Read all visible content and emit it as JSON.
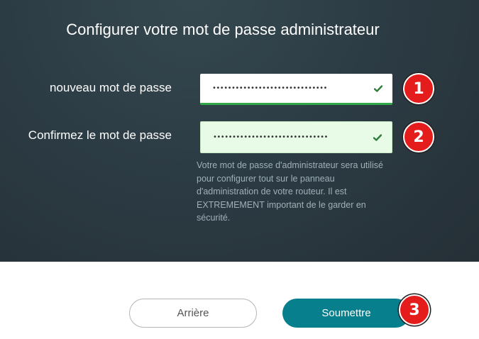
{
  "header": {
    "title": "Configurer votre mot de passe administrateur"
  },
  "form": {
    "new_password": {
      "label": "nouveau mot de passe",
      "masked_value": "••••••••••••••••••••••••••••••",
      "status_icon": "check-icon"
    },
    "confirm_password": {
      "label": "Confirmez le mot de passe",
      "masked_value": "••••••••••••••••••••••••••••••",
      "status_icon": "check-icon"
    },
    "help_text": "Votre mot de passe d'administrateur sera utilisé pour configurer tout sur le panneau d'administration de votre routeur. Il est EXTREMEMENT important de le garder en sécurité."
  },
  "annotations": [
    "1",
    "2",
    "3"
  ],
  "actions": {
    "back_label": "Arrière",
    "submit_label": "Soumettre"
  },
  "colors": {
    "panel_bg": "#2b3a42",
    "accent_teal": "#087f8c",
    "valid_green": "#31a84a",
    "badge_red": "#e41c1c"
  }
}
